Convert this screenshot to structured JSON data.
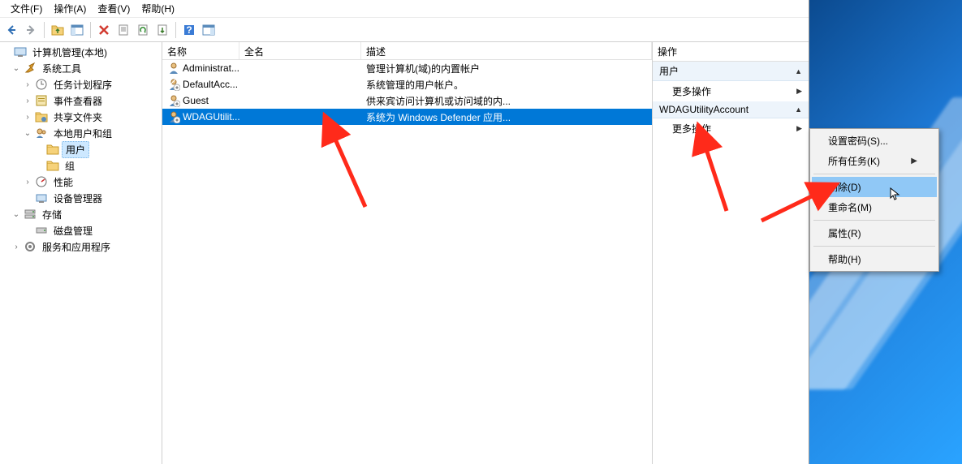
{
  "menubar": {
    "file": "文件(F)",
    "action": "操作(A)",
    "view": "查看(V)",
    "help": "帮助(H)"
  },
  "tree": {
    "root": "计算机管理(本地)",
    "sys_tools": "系统工具",
    "task_scheduler": "任务计划程序",
    "event_viewer": "事件查看器",
    "shared_folders": "共享文件夹",
    "local_users": "本地用户和组",
    "users": "用户",
    "groups": "组",
    "performance": "性能",
    "device_manager": "设备管理器",
    "storage": "存储",
    "disk_mgmt": "磁盘管理",
    "services_apps": "服务和应用程序"
  },
  "columns": {
    "name": "名称",
    "fullname": "全名",
    "desc": "描述"
  },
  "users": [
    {
      "name": "Administrat...",
      "fullname": "",
      "desc": "管理计算机(域)的内置帐户",
      "disabled": false
    },
    {
      "name": "DefaultAcc...",
      "fullname": "",
      "desc": "系统管理的用户帐户。",
      "disabled": true
    },
    {
      "name": "Guest",
      "fullname": "",
      "desc": "供来宾访问计算机或访问域的内...",
      "disabled": true
    },
    {
      "name": "WDAGUtilit...",
      "fullname": "",
      "desc": "系统为 Windows Defender 应用...",
      "disabled": true
    }
  ],
  "actions": {
    "panel_title": "操作",
    "section_user": "用户",
    "more_actions": "更多操作",
    "section_account": "WDAGUtilityAccount"
  },
  "context_menu": {
    "set_password": "设置密码(S)...",
    "all_tasks": "所有任务(K)",
    "delete": "删除(D)",
    "rename": "重命名(M)",
    "properties": "属性(R)",
    "help": "帮助(H)"
  }
}
